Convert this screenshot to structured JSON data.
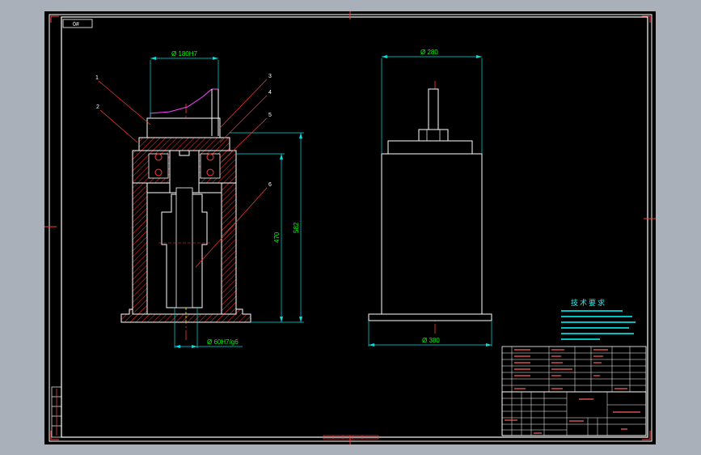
{
  "drawing": {
    "sheet_code": "0#",
    "front_view": {
      "top_dim": "Ø 180H7",
      "bottom_dim": "Ø 60H7/g6",
      "height_inner": "470",
      "height_total": "582",
      "balloons": [
        "1",
        "2",
        "3",
        "4",
        "5",
        "6"
      ]
    },
    "side_view": {
      "top_dim": "Ø 280",
      "bottom_dim": "Ø 380"
    },
    "tech_requirements_title": "技术要求"
  }
}
